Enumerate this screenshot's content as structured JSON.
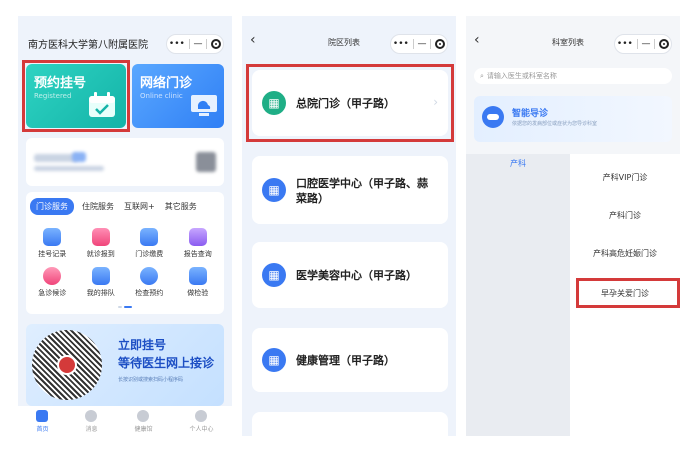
{
  "panel1": {
    "hospital_title": "南方医科大学第八附属医院",
    "card_register": {
      "title": "预约挂号",
      "subtitle": "Registered"
    },
    "card_online": {
      "title": "网络门诊",
      "subtitle": "Online clinic"
    },
    "tabs": [
      "门诊服务",
      "住院服务",
      "互联网+",
      "其它服务"
    ],
    "services": [
      "挂号记录",
      "就诊报到",
      "门诊缴费",
      "报告查询",
      "急诊候诊",
      "我的排队",
      "检查预约",
      "做检验"
    ],
    "banner": {
      "line1": "立即挂号",
      "line2": "等待医生网上接诊",
      "line3": "长按识别或搜索扫码小程序码"
    },
    "tabbar": [
      "首页",
      "消息",
      "健康馆",
      "个人中心"
    ]
  },
  "panel2": {
    "nav_title": "院区列表",
    "departments": [
      "总院门诊（甲子路）",
      "口腔医学中心（甲子路、蒜菜路）",
      "医学美容中心（甲子路）",
      "健康管理（甲子路）"
    ]
  },
  "panel3": {
    "nav_title": "科室列表",
    "search_placeholder": "请输入医生或科室名称",
    "guide": {
      "title": "智能导诊",
      "subtitle": "依据您的发病部位或症状为您导诊科室"
    },
    "category": "产科",
    "sub_departments": [
      "产科VIP门诊",
      "产科门诊",
      "产科高危妊娠门诊",
      "早孕关爱门诊"
    ]
  },
  "colors": {
    "accent": "#3a79f2",
    "highlight": "#d43a3a",
    "teal": "#1cc2b4"
  }
}
